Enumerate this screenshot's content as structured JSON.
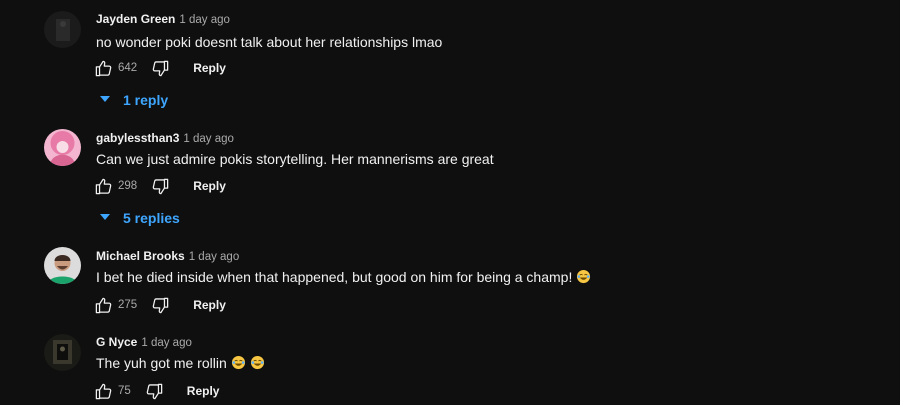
{
  "comments": [
    {
      "author": "Jayden Green",
      "time": "1 day ago",
      "text": "no wonder poki doesnt talk about her relationships lmao",
      "likes": "642",
      "reply_label": "Reply",
      "replies_label": "1 reply",
      "avatar": "dark-figure-avatar"
    },
    {
      "author": "gabylessthan3",
      "time": "1 day ago",
      "text": "Can we just admire pokis storytelling. Her mannerisms are great",
      "likes": "298",
      "reply_label": "Reply",
      "replies_label": "5 replies",
      "avatar": "pink-hair-avatar"
    },
    {
      "author": "Michael Brooks",
      "time": "1 day ago",
      "text": "I bet he died inside when that happened, but good on him for being a champ!",
      "emoji_count": 1,
      "likes": "275",
      "reply_label": "Reply",
      "avatar": "smiling-man-avatar"
    },
    {
      "author": "G Nyce",
      "time": "1 day ago",
      "text": "The yuh got me rollin",
      "emoji_count": 2,
      "likes": "75",
      "reply_label": "Reply",
      "avatar": "dark-room-avatar"
    }
  ],
  "colors": {
    "background": "#0f0f0f",
    "link": "#3ea6ff",
    "meta": "#aaaaaa"
  },
  "icons": {
    "like": "thumbs-up-icon",
    "dislike": "thumbs-down-icon",
    "expand": "caret-down-icon",
    "emoji": "laughing-tears-emoji"
  }
}
